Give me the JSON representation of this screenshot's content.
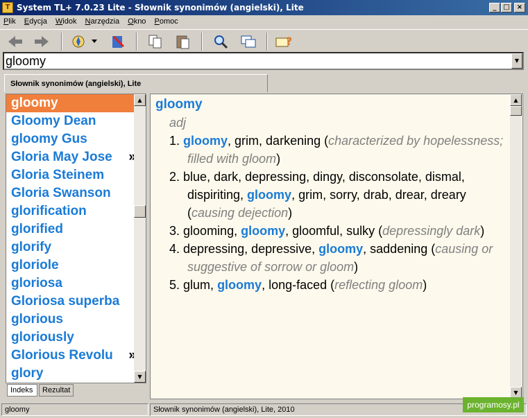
{
  "window": {
    "title": "System TL+ 7.0.23 Lite - Słownik synonimów (angielski), Lite"
  },
  "menu": [
    "Plik",
    "Edycja",
    "Widok",
    "Narzędzia",
    "Okno",
    "Pomoc"
  ],
  "search": {
    "value": "gloomy"
  },
  "doc_tab": {
    "label": "Słownik synonimów (angielski), Lite"
  },
  "wordlist": [
    {
      "text": "gloomy",
      "selected": true
    },
    {
      "text": "Gloomy Dean"
    },
    {
      "text": "gloomy Gus"
    },
    {
      "text": "Gloria May Jose",
      "more": "»"
    },
    {
      "text": "Gloria Steinem"
    },
    {
      "text": "Gloria Swanson"
    },
    {
      "text": "glorification"
    },
    {
      "text": "glorified"
    },
    {
      "text": "glorify"
    },
    {
      "text": "gloriole"
    },
    {
      "text": "gloriosa"
    },
    {
      "text": "Gloriosa superba"
    },
    {
      "text": "glorious"
    },
    {
      "text": "gloriously"
    },
    {
      "text": "Glorious Revolu",
      "more": "»"
    },
    {
      "text": "glory"
    }
  ],
  "bottom_tabs": {
    "index": "Indeks",
    "result": "Rezultat"
  },
  "entry": {
    "headword": "gloomy",
    "pos": "adj",
    "senses": [
      {
        "num": "1.",
        "parts": [
          {
            "t": "gloomy",
            "hl": true
          },
          {
            "t": ", grim, darkening ("
          },
          {
            "t": "characterized by hopelessness; filled with gloom",
            "gloss": true
          },
          {
            "t": ")"
          }
        ]
      },
      {
        "num": "2.",
        "parts": [
          {
            "t": "blue, dark, depressing, dingy, disconsolate, dismal, dispiriting, "
          },
          {
            "t": "gloomy",
            "hl": true
          },
          {
            "t": ", grim, sorry, drab, drear, dreary ("
          },
          {
            "t": "causing dejection",
            "gloss": true
          },
          {
            "t": ")"
          }
        ]
      },
      {
        "num": "3.",
        "parts": [
          {
            "t": "glooming, "
          },
          {
            "t": "gloomy",
            "hl": true
          },
          {
            "t": ", gloomful, sulky ("
          },
          {
            "t": "depressingly dark",
            "gloss": true
          },
          {
            "t": ")"
          }
        ]
      },
      {
        "num": "4.",
        "parts": [
          {
            "t": "depressing, depressive, "
          },
          {
            "t": "gloomy",
            "hl": true
          },
          {
            "t": ", saddening ("
          },
          {
            "t": "causing or suggestive of sorrow or gloom",
            "gloss": true
          },
          {
            "t": ")"
          }
        ]
      },
      {
        "num": "5.",
        "parts": [
          {
            "t": "glum, "
          },
          {
            "t": "gloomy",
            "hl": true
          },
          {
            "t": ", long-faced ("
          },
          {
            "t": "reflecting gloom",
            "gloss": true
          },
          {
            "t": ")"
          }
        ]
      }
    ]
  },
  "status": {
    "left": "gloomy",
    "right": "Słownik synonimów (angielski), Lite, 2010"
  },
  "watermark": "programosy.pl",
  "colors": {
    "accent": "#1a7bd6",
    "selection": "#f07f3c",
    "content_bg": "#fdf9ec"
  }
}
